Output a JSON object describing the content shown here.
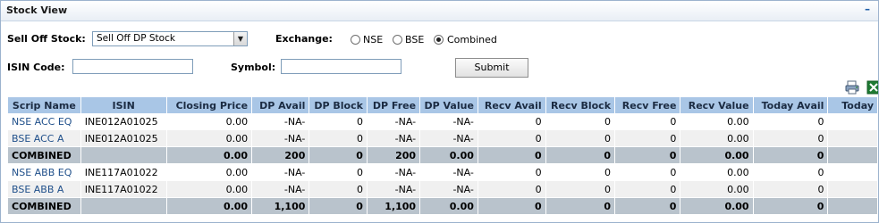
{
  "panel": {
    "title": "Stock View",
    "minimize_glyph": "–"
  },
  "form": {
    "sell_off_label": "Sell Off Stock:",
    "sell_off_value": "Sell Off DP Stock",
    "exchange_label": "Exchange:",
    "exchange_options": [
      "NSE",
      "BSE",
      "Combined"
    ],
    "exchange_selected": "Combined",
    "isin_label": "ISIN Code:",
    "isin_value": "",
    "symbol_label": "Symbol:",
    "symbol_value": "",
    "submit_label": "Submit"
  },
  "toolbar": {
    "icons": [
      "print-icon",
      "excel-export-icon"
    ]
  },
  "table": {
    "columns": [
      "Scrip Name",
      "ISIN",
      "Closing Price",
      "DP Avail",
      "DP Block",
      "DP Free",
      "DP Value",
      "Recv Avail",
      "Recv Block",
      "Recv Free",
      "Recv Value",
      "Today Avail",
      "Today"
    ],
    "rows": [
      {
        "type": "data",
        "cells": [
          "NSE ACC EQ",
          "INE012A01025",
          "0.00",
          "-NA-",
          "0",
          "-NA-",
          "-NA-",
          "0",
          "0",
          "0",
          "0.00",
          "0",
          ""
        ]
      },
      {
        "type": "data",
        "cells": [
          "BSE ACC A",
          "INE012A01025",
          "0.00",
          "-NA-",
          "0",
          "-NA-",
          "-NA-",
          "0",
          "0",
          "0",
          "0.00",
          "0",
          ""
        ]
      },
      {
        "type": "total",
        "cells": [
          "COMBINED",
          "",
          "0.00",
          "200",
          "0",
          "200",
          "0.00",
          "0",
          "0",
          "0",
          "0.00",
          "0",
          ""
        ]
      },
      {
        "type": "data",
        "cells": [
          "NSE ABB EQ",
          "INE117A01022",
          "0.00",
          "-NA-",
          "0",
          "-NA-",
          "-NA-",
          "0",
          "0",
          "0",
          "0.00",
          "0",
          ""
        ]
      },
      {
        "type": "data",
        "cells": [
          "BSE ABB A",
          "INE117A01022",
          "0.00",
          "-NA-",
          "0",
          "-NA-",
          "-NA-",
          "0",
          "0",
          "0",
          "0.00",
          "0",
          ""
        ]
      },
      {
        "type": "total",
        "cells": [
          "COMBINED",
          "",
          "0.00",
          "1,100",
          "0",
          "1,100",
          "0.00",
          "0",
          "0",
          "0",
          "0.00",
          "0",
          ""
        ]
      }
    ]
  }
}
